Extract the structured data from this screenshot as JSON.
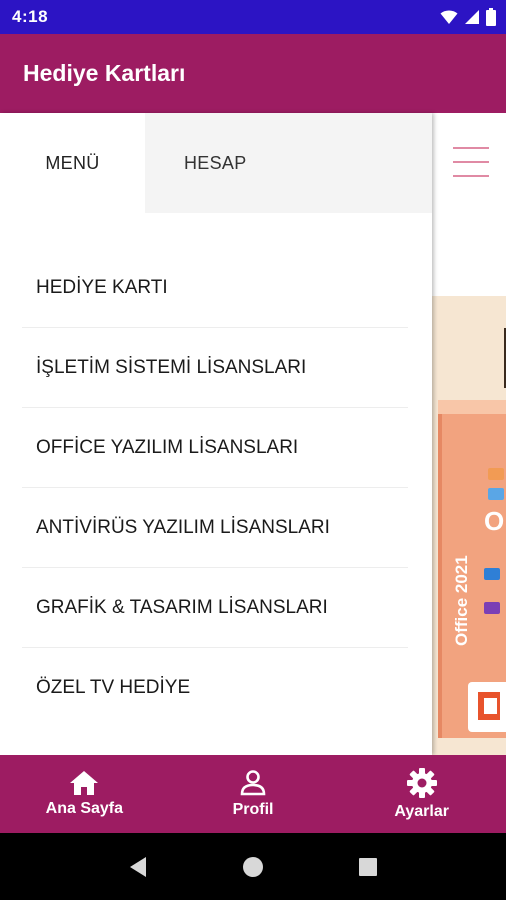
{
  "status_bar": {
    "time": "4:18",
    "icons": [
      "wifi-icon",
      "signal-icon",
      "battery-icon"
    ]
  },
  "app_bar": {
    "title": "Hediye Kartları"
  },
  "drawer": {
    "tabs": [
      {
        "label": "MENÜ",
        "selected": true
      },
      {
        "label": "HESAP",
        "selected": false
      }
    ],
    "menu_items": [
      {
        "label": "HEDİYE KARTI"
      },
      {
        "label": "İŞLETİM SİSTEMİ LİSANSLARI"
      },
      {
        "label": "OFFİCE YAZILIM LİSANSLARI"
      },
      {
        "label": "ANTİVİRÜS YAZILIM LİSANSLARI"
      },
      {
        "label": "GRAFİK & TASARIM LİSANSLARI"
      },
      {
        "label": "ÖZEL TV HEDİYE"
      }
    ]
  },
  "background_content": {
    "menu_icon": "hamburger-menu-icon",
    "promo_text": "Office 2021",
    "promo_letter": "O"
  },
  "bottom_nav": {
    "items": [
      {
        "label": "Ana Sayfa",
        "icon": "home-icon"
      },
      {
        "label": "Profil",
        "icon": "person-icon"
      },
      {
        "label": "Ayarlar",
        "icon": "gear-icon"
      }
    ]
  },
  "system_nav": {
    "buttons": [
      "back-icon",
      "home-circle-icon",
      "recents-icon"
    ]
  },
  "colors": {
    "status_bar": "#2c14c4",
    "primary": "#9d1c62",
    "tab_inactive_bg": "#f4f4f4",
    "hamburger": "#e08aa4",
    "promo_bg": "#f6e6d2",
    "office_box": "#f2a37f"
  }
}
